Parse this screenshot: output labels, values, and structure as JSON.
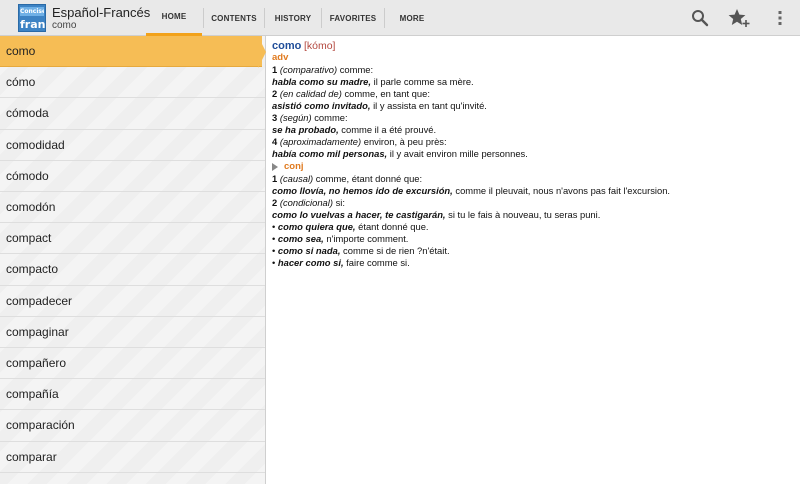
{
  "app": {
    "icon_top_text": "Concise",
    "icon_bottom_text": "fran",
    "title": "Español-Francés",
    "subtitle": "como"
  },
  "tabs": [
    {
      "label": "HOME",
      "active": true
    },
    {
      "label": "CONTENTS",
      "active": false
    },
    {
      "label": "HISTORY",
      "active": false
    },
    {
      "label": "FAVORITES",
      "active": false
    },
    {
      "label": "MORE",
      "active": false
    }
  ],
  "actions": [
    {
      "icon": "search-icon"
    },
    {
      "icon": "star-add-icon"
    },
    {
      "icon": "overflow-menu-icon"
    }
  ],
  "accent_color": "#f6bd55",
  "word_list": [
    "como",
    "cómo",
    "cómoda",
    "comodidad",
    "cómodo",
    "comodón",
    "compact",
    "compacto",
    "compadecer",
    "compaginar",
    "compañero",
    "compañía",
    "comparación",
    "comparar"
  ],
  "selected_index": 0,
  "entry": {
    "headword": "como",
    "pronunciation": "[kómo]",
    "adv": {
      "pos": "adv",
      "senses": [
        {
          "num": "1",
          "gloss": "(comparativo)",
          "trans": " comme:",
          "example": "habla como su madre,",
          "example_trans": " il parle comme sa mère."
        },
        {
          "num": "2",
          "gloss": "(en calidad de)",
          "trans": " comme, en tant que:",
          "example": "asistió como invitado,",
          "example_trans": " il y assista en tant qu'invité."
        },
        {
          "num": "3",
          "gloss": "(según)",
          "trans": " comme:",
          "example": "se ha probado,",
          "example_trans": " comme il a été prouvé."
        },
        {
          "num": "4",
          "gloss": "(aproximadamente)",
          "trans": " environ, à peu près:",
          "example": "había como mil personas,",
          "example_trans": " il y avait environ mille personnes."
        }
      ]
    },
    "conj": {
      "pos": "conj",
      "senses": [
        {
          "num": "1",
          "gloss": "(causal)",
          "trans": " comme, étant donné que:",
          "example": "como llovía, no hemos ido de excursión,",
          "example_trans": " comme il pleuvait, nous n'avons pas fait l'excursion."
        },
        {
          "num": "2",
          "gloss": "(condicional)",
          "trans": " si:",
          "example": "como lo vuelvas a hacer, te castigarán,",
          "example_trans": " si tu le fais à nouveau, tu seras puni."
        }
      ]
    },
    "phrases": [
      {
        "phrase": "como quiera que,",
        "trans": " étant donné que."
      },
      {
        "phrase": "como sea,",
        "trans": " n'importe comment."
      },
      {
        "phrase": "como si nada,",
        "trans": " comme si de rien ?n'était."
      },
      {
        "phrase": "hacer como si,",
        "trans": " faire comme si."
      }
    ]
  }
}
